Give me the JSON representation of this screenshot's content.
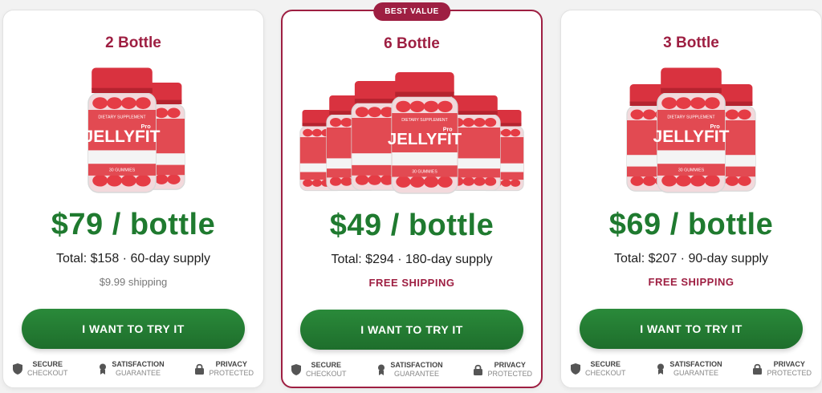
{
  "cards": [
    {
      "title": "2 Bottle",
      "price": "$79 / bottle",
      "total": "Total: $158 · 60-day supply",
      "shipping": "$9.99 shipping",
      "cta": "I WANT TO TRY IT",
      "bottle_count": 2
    },
    {
      "badge": "BEST VALUE",
      "title": "6 Bottle",
      "price": "$49 / bottle",
      "total": "Total: $294 · 180-day supply",
      "shipping": "FREE SHIPPING",
      "cta": "I WANT TO TRY IT",
      "bottle_count": 6
    },
    {
      "title": "3 Bottle",
      "price": "$69 / bottle",
      "total": "Total: $207 · 90-day supply",
      "shipping": "FREE SHIPPING",
      "cta": "I WANT TO TRY IT",
      "bottle_count": 3
    }
  ],
  "trust": [
    {
      "top": "SECURE",
      "bottom": "CHECKOUT",
      "icon": "shield-icon"
    },
    {
      "top": "SATISFACTION",
      "bottom": "GUARANTEE",
      "icon": "award-ribbon-icon"
    },
    {
      "top": "PRIVACY",
      "bottom": "PROTECTED",
      "icon": "lock-icon"
    }
  ],
  "product": {
    "brand": "JELLYFIT",
    "brand_suffix": "Pro",
    "label_top": "DIETARY SUPPLEMENT",
    "label_bottom": "30 GUMMIES"
  },
  "colors": {
    "accent": "#9e1f42",
    "price_green": "#1f7a2f",
    "cta_green": "#247c33",
    "bottle_red": "#d9323f"
  }
}
